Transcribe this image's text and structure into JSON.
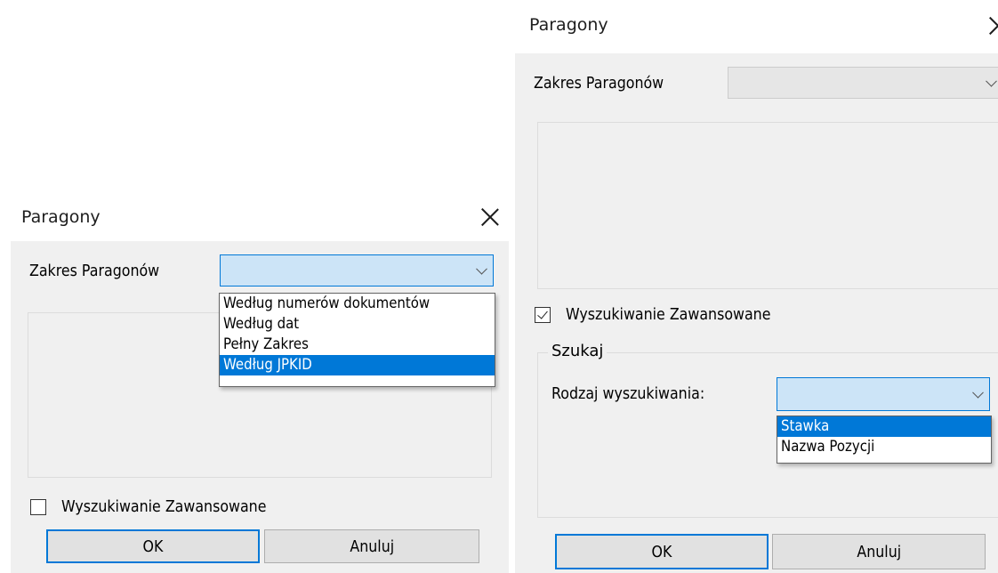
{
  "left_dialog": {
    "title": "Paragony",
    "range_label": "Zakres Paragonów",
    "range_options": [
      "Według numerów dokumentów",
      "Według dat",
      "Pełny Zakres",
      "Według JPKID"
    ],
    "range_selected_index": 3,
    "advanced_label": "Wyszukiwanie Zawansowane",
    "advanced_checked": false,
    "ok_label": "OK",
    "cancel_label": "Anuluj"
  },
  "right_dialog": {
    "title": "Paragony",
    "range_label": "Zakres Paragonów",
    "advanced_label": "Wyszukiwanie Zawansowane",
    "advanced_checked": true,
    "search_group_label": "Szukaj",
    "search_type_label": "Rodzaj wyszukiwania:",
    "search_type_options": [
      "Stawka",
      "Nazwa Pozycji"
    ],
    "search_type_selected_index": 0,
    "ok_label": "OK",
    "cancel_label": "Anuluj"
  },
  "colors": {
    "accent": "#0078d7",
    "dialog_bg": "#f0f0f0",
    "combo_active_bg": "#cce4f7"
  }
}
